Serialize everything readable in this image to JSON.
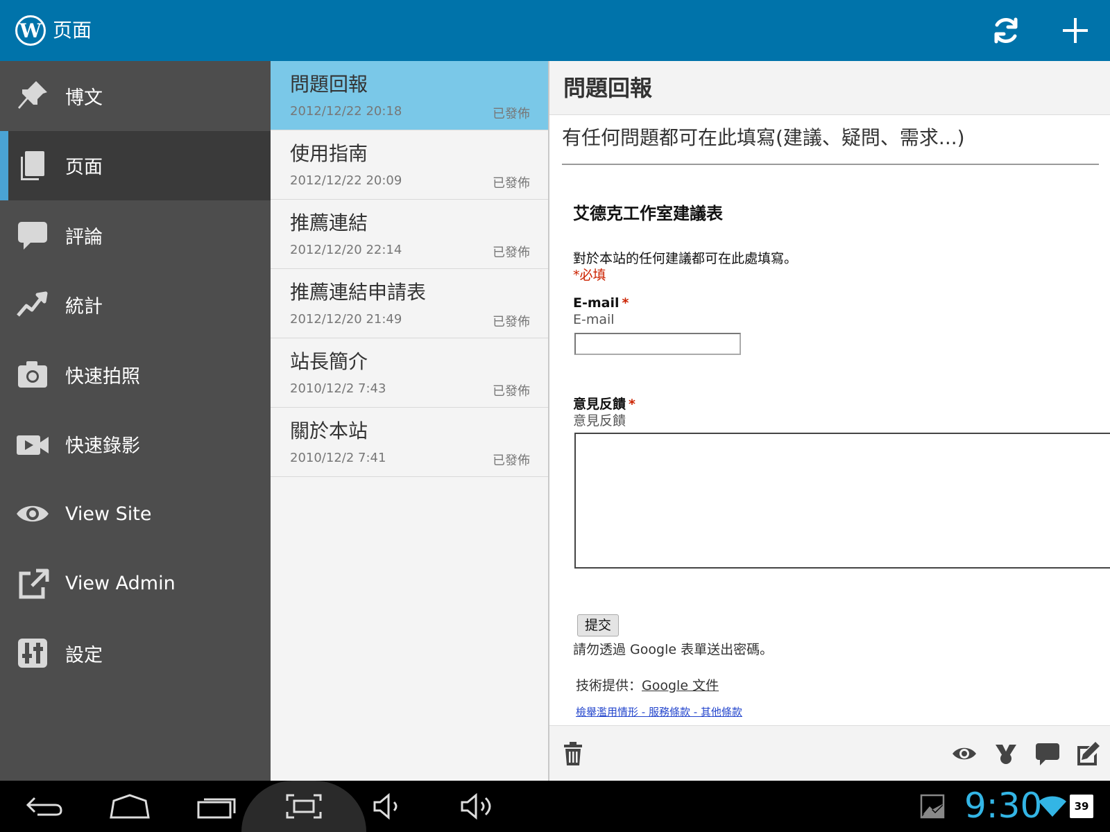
{
  "action_bar": {
    "logo_letter": "W",
    "title": "页面",
    "refresh_icon": "refresh-icon",
    "add_icon": "plus-icon"
  },
  "sidebar": {
    "items": [
      {
        "label": "博文",
        "icon": "pin-icon"
      },
      {
        "label": "页面",
        "icon": "pages-icon",
        "active": true
      },
      {
        "label": "評論",
        "icon": "comment-icon"
      },
      {
        "label": "統計",
        "icon": "stats-icon"
      },
      {
        "label": "快速拍照",
        "icon": "camera-icon"
      },
      {
        "label": "快速錄影",
        "icon": "video-icon"
      },
      {
        "label": "View Site",
        "icon": "eye-icon"
      },
      {
        "label": "View Admin",
        "icon": "external-link-icon"
      },
      {
        "label": "設定",
        "icon": "settings-icon"
      }
    ]
  },
  "pages": [
    {
      "title": "問題回報",
      "date": "2012/12/22 20:18",
      "status": "已發佈"
    },
    {
      "title": "使用指南",
      "date": "2012/12/22 20:09",
      "status": "已發佈"
    },
    {
      "title": "推薦連結",
      "date": "2012/12/20 22:14",
      "status": "已發佈"
    },
    {
      "title": "推薦連結申請表",
      "date": "2012/12/20 21:49",
      "status": "已發佈"
    },
    {
      "title": "站長簡介",
      "date": "2010/12/2 7:43",
      "status": "已發佈"
    },
    {
      "title": "關於本站",
      "date": "2010/12/2 7:41",
      "status": "已發佈"
    }
  ],
  "preview": {
    "title": "問題回報",
    "description": "有任何問題都可在此填寫(建議、疑問、需求...)",
    "form": {
      "title": "艾德克工作室建議表",
      "description": "對於本站的任何建議都可在此處填寫。",
      "required_note": "*必填",
      "email_label": "E-mail",
      "email_help": "E-mail",
      "feedback_label": "意見反饋",
      "feedback_help": "意見反饋",
      "star": "*",
      "submit": "提交",
      "password_note": "請勿透過 Google 表單送出密碼。",
      "powered_prefix": "技術提供：",
      "powered_link": "Google 文件",
      "footer_links": "檢舉濫用情形 - 服務條款 - 其他條款"
    }
  },
  "clock": "9:30",
  "battery": "39",
  "colors": {
    "action_bar": "#0073aa",
    "sidebar": "#4d4d4d",
    "selected_item": "#7ac8e8",
    "accent": "#33b5e5"
  }
}
